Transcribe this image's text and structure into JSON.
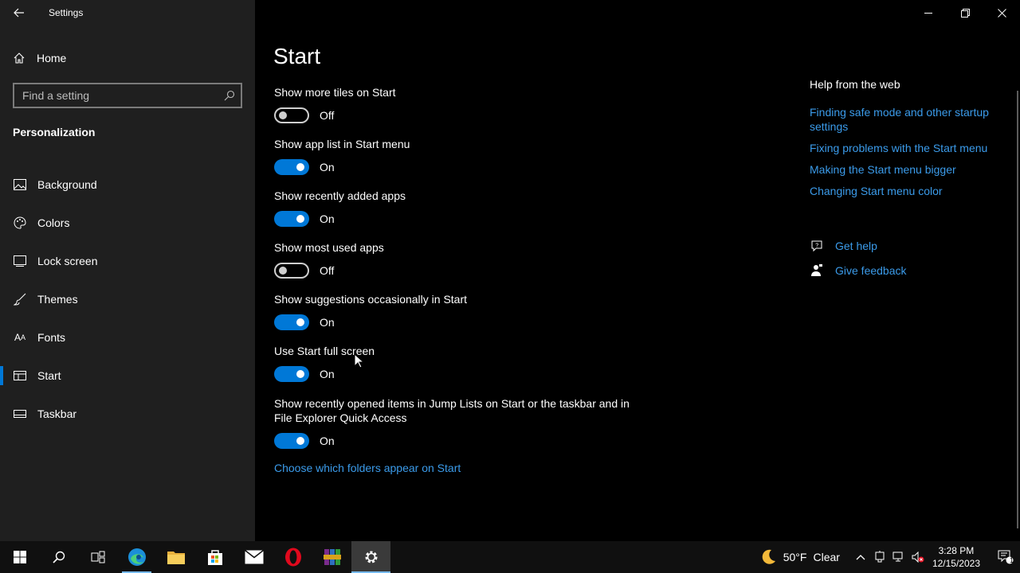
{
  "window": {
    "title": "Settings"
  },
  "sidebar": {
    "home_label": "Home",
    "search_placeholder": "Find a setting",
    "section": "Personalization",
    "items": [
      {
        "label": "Background",
        "icon": "image-icon"
      },
      {
        "label": "Colors",
        "icon": "palette-icon"
      },
      {
        "label": "Lock screen",
        "icon": "lock-screen-icon"
      },
      {
        "label": "Themes",
        "icon": "brush-icon"
      },
      {
        "label": "Fonts",
        "icon": "font-icon"
      },
      {
        "label": "Start",
        "icon": "start-layout-icon",
        "active": true
      },
      {
        "label": "Taskbar",
        "icon": "taskbar-icon"
      }
    ]
  },
  "main": {
    "title": "Start",
    "settings": [
      {
        "label": "Show more tiles on Start",
        "state": "Off"
      },
      {
        "label": "Show app list in Start menu",
        "state": "On"
      },
      {
        "label": "Show recently added apps",
        "state": "On"
      },
      {
        "label": "Show most used apps",
        "state": "Off"
      },
      {
        "label": "Show suggestions occasionally in Start",
        "state": "On"
      },
      {
        "label": "Use Start full screen",
        "state": "On"
      },
      {
        "label": "Show recently opened items in Jump Lists on Start or the taskbar and in File Explorer Quick Access",
        "state": "On"
      }
    ],
    "folders_link": "Choose which folders appear on Start"
  },
  "help": {
    "title": "Help from the web",
    "links": [
      "Finding safe mode and other startup settings",
      "Fixing problems with the Start menu",
      "Making the Start menu bigger",
      "Changing Start menu color"
    ],
    "get_help": "Get help",
    "give_feedback": "Give feedback"
  },
  "taskbar": {
    "apps": [
      "start-icon",
      "search-icon",
      "task-view-icon",
      "edge-icon",
      "file-explorer-icon",
      "store-icon",
      "mail-icon",
      "opera-icon",
      "winrar-icon",
      "settings-icon"
    ],
    "weather_temp": "50°F",
    "weather_desc": "Clear",
    "time": "3:28 PM",
    "date": "12/15/2023",
    "notification_count": "1"
  },
  "colors": {
    "accent": "#0078d7",
    "link": "#3b9bea",
    "sidebar_bg": "#1f1f1f",
    "main_bg": "#000000"
  }
}
